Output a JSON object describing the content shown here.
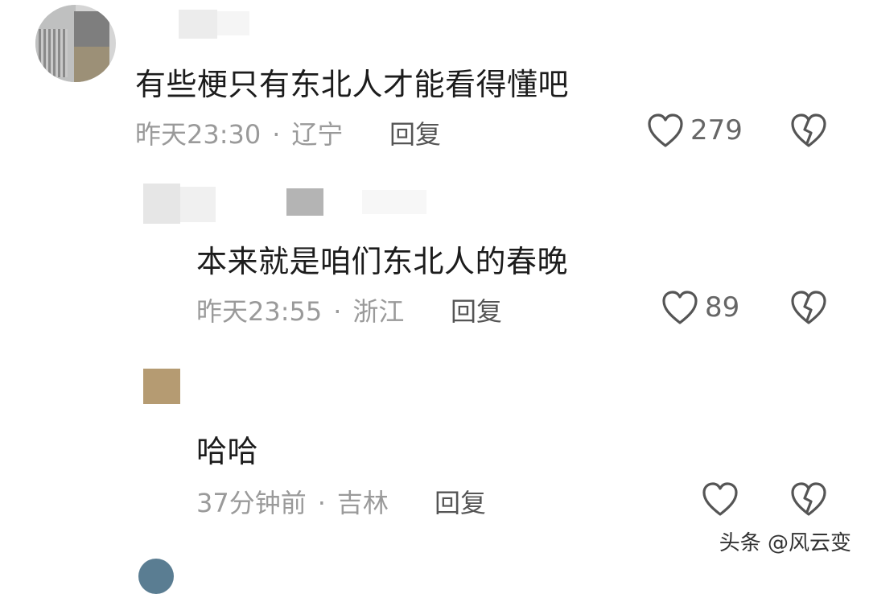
{
  "comments": [
    {
      "text": "有些梗只有东北人才能看得懂吧",
      "time": "昨天23:30",
      "sep": "·",
      "location": "辽宁",
      "reply_label": "回复",
      "likes": "279"
    },
    {
      "text": "本来就是咱们东北人的春晚",
      "time": "昨天23:55",
      "sep": "·",
      "location": "浙江",
      "reply_label": "回复",
      "likes": "89"
    },
    {
      "text": "哈哈",
      "time": "37分钟前",
      "sep": "·",
      "location": "吉林",
      "reply_label": "回复",
      "likes": ""
    }
  ],
  "watermark": "头条 @风云变",
  "icons": {
    "like": "heart-outline-icon",
    "dislike": "broken-heart-icon"
  },
  "colors": {
    "text": "#1c1c1c",
    "meta": "#9a9a9a",
    "icon": "#555555"
  }
}
